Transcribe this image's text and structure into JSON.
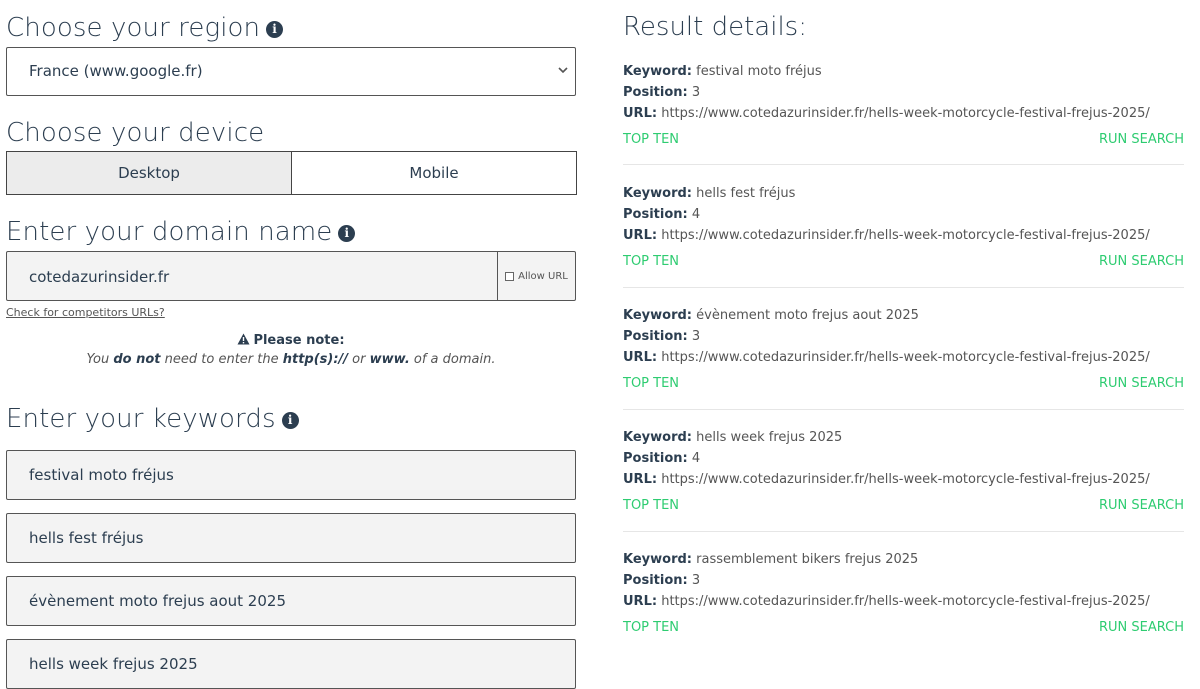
{
  "region": {
    "heading": "Choose your region",
    "selected": "France (www.google.fr)"
  },
  "device": {
    "heading": "Choose your device",
    "options": [
      "Desktop",
      "Mobile"
    ],
    "selected": "Desktop"
  },
  "domain": {
    "heading": "Enter your domain name",
    "value": "cotedazurinsider.fr",
    "allow_url_label": "Allow URL",
    "competitors_link": "Check for competitors URLs?"
  },
  "note": {
    "title": "Please note:",
    "text_prefix": "You ",
    "text_bold1": "do not",
    "text_mid": " need to enter the ",
    "text_bold2": "http(s)://",
    "text_or": " or ",
    "text_bold3": "www.",
    "text_suffix": " of a domain."
  },
  "keywords": {
    "heading": "Enter your keywords",
    "items": [
      "festival moto fréjus",
      "hells fest fréjus",
      "évènement moto frejus aout 2025",
      "hells week frejus 2025"
    ]
  },
  "results": {
    "title": "Result details:",
    "labels": {
      "keyword": "Keyword:",
      "position": "Position:",
      "url": "URL:",
      "top_ten": "TOP TEN",
      "run_search": "RUN SEARCH"
    },
    "items": [
      {
        "keyword": "festival moto fréjus",
        "position": "3",
        "url": "https://www.cotedazurinsider.fr/hells-week-motorcycle-festival-frejus-2025/"
      },
      {
        "keyword": "hells fest fréjus",
        "position": "4",
        "url": "https://www.cotedazurinsider.fr/hells-week-motorcycle-festival-frejus-2025/"
      },
      {
        "keyword": "évènement moto frejus aout 2025",
        "position": "3",
        "url": "https://www.cotedazurinsider.fr/hells-week-motorcycle-festival-frejus-2025/"
      },
      {
        "keyword": "hells week frejus 2025",
        "position": "4",
        "url": "https://www.cotedazurinsider.fr/hells-week-motorcycle-festival-frejus-2025/"
      },
      {
        "keyword": "rassemblement bikers frejus 2025",
        "position": "3",
        "url": "https://www.cotedazurinsider.fr/hells-week-motorcycle-festival-frejus-2025/"
      }
    ]
  },
  "colors": {
    "text": "#2c3e50",
    "accent_green": "#2ecc71",
    "input_bg": "#f3f3f3"
  }
}
